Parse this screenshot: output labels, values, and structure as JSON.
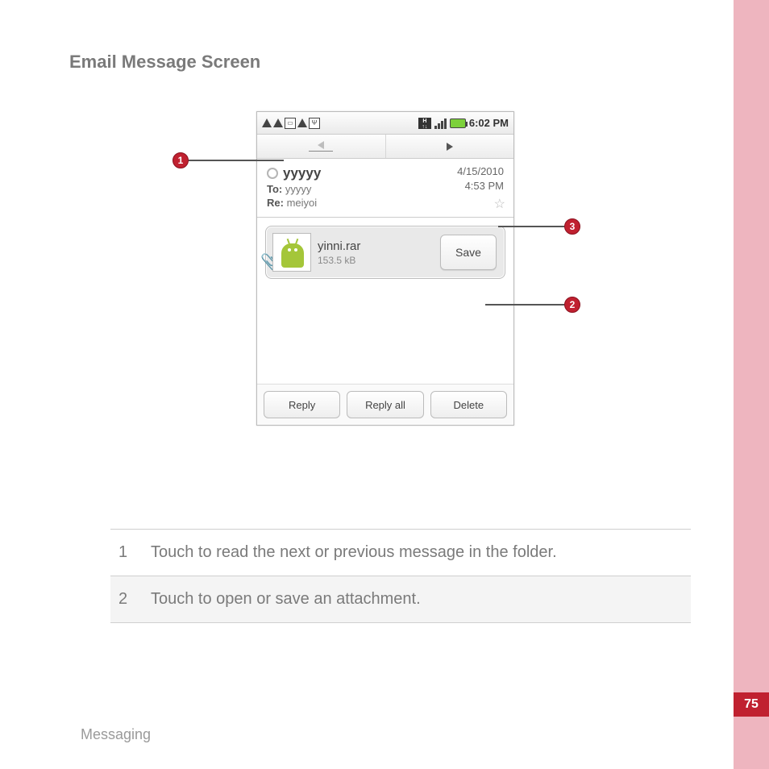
{
  "page": {
    "heading": "Email Message Screen",
    "footer": "Messaging",
    "number": "75"
  },
  "status": {
    "time": "6:02 PM"
  },
  "message": {
    "from": "yyyyy",
    "to_label": "To:",
    "to": "yyyyy",
    "subject_label": "Re:",
    "subject": "meiyoi",
    "date": "4/15/2010",
    "time": "4:53 PM"
  },
  "attachment": {
    "name": "yinni.rar",
    "size": "153.5 kB",
    "save_label": "Save"
  },
  "buttons": {
    "reply": "Reply",
    "reply_all": "Reply all",
    "delete": "Delete"
  },
  "callouts": {
    "c1": "1",
    "c2": "2",
    "c3": "3"
  },
  "table": {
    "rows": [
      {
        "num": "1",
        "desc": "Touch to read the next or previous message in the folder."
      },
      {
        "num": "2",
        "desc": "Touch to open or save an attachment."
      }
    ]
  }
}
